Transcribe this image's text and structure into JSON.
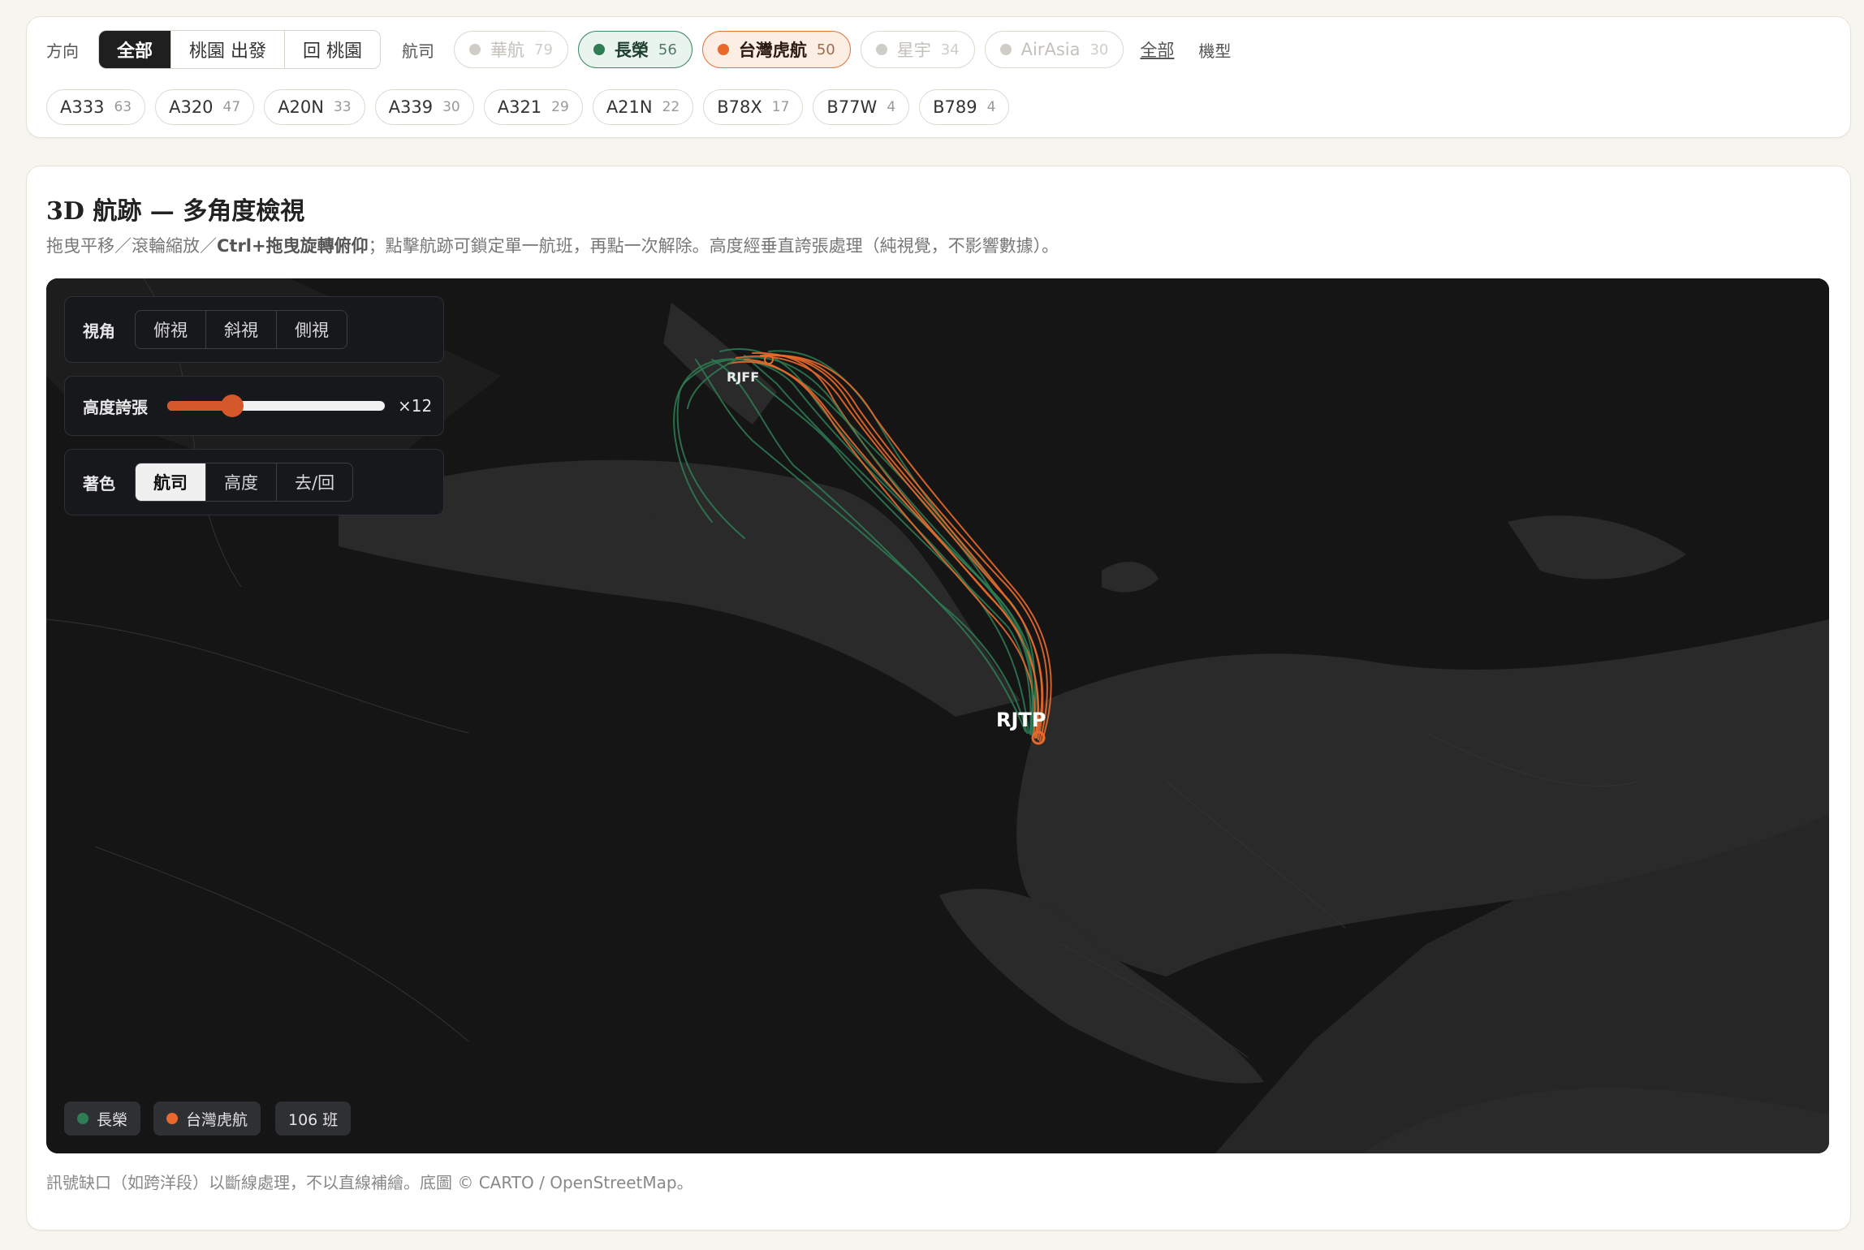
{
  "filters": {
    "direction_label": "方向",
    "direction_options": [
      "全部",
      "桃園 出發",
      "回 桃園"
    ],
    "airline_label": "航司",
    "airlines": [
      {
        "name": "華航",
        "count": "79",
        "state": "off"
      },
      {
        "name": "長榮",
        "count": "56",
        "state": "on",
        "color": "#2e7d55"
      },
      {
        "name": "台灣虎航",
        "count": "50",
        "state": "on",
        "color": "#e8692b"
      },
      {
        "name": "星宇",
        "count": "34",
        "state": "off"
      },
      {
        "name": "AirAsia",
        "count": "30",
        "state": "off"
      }
    ],
    "all_link": "全部",
    "aircraft_label": "機型",
    "aircraft": [
      {
        "code": "A333",
        "count": "63"
      },
      {
        "code": "A320",
        "count": "47"
      },
      {
        "code": "A20N",
        "count": "33"
      },
      {
        "code": "A339",
        "count": "30"
      },
      {
        "code": "A321",
        "count": "29"
      },
      {
        "code": "A21N",
        "count": "22"
      },
      {
        "code": "B78X",
        "count": "17"
      },
      {
        "code": "B77W",
        "count": "4"
      },
      {
        "code": "B789",
        "count": "4"
      }
    ]
  },
  "map_section": {
    "title": "3D 航跡 — 多角度檢視",
    "desc_part1": "拖曳平移／滾輪縮放／",
    "desc_bold": "Ctrl+拖曳旋轉俯仰",
    "desc_part2": "；點擊航跡可鎖定單一航班，再點一次解除。高度經垂直誇張處理（純視覺，不影響數據）。",
    "footnote": "訊號缺口（如跨洋段）以斷線處理，不以直線補繪。底圖 © CARTO / OpenStreetMap。"
  },
  "controls": {
    "view_label": "視角",
    "view_options": [
      "俯視",
      "斜視",
      "側視"
    ],
    "exag_label": "高度誇張",
    "exag_value": "×12",
    "exag_fraction": 0.3,
    "color_label": "著色",
    "color_options": [
      "航司",
      "高度",
      "去/回"
    ]
  },
  "legend": {
    "evr": "長榮",
    "tig": "台灣虎航",
    "count": "106 班"
  },
  "airports": {
    "origin": "RJTP",
    "dest": "RJFF"
  },
  "colors": {
    "evr": "#2e7d55",
    "tig": "#e8692b",
    "accent": "#d4582a"
  }
}
